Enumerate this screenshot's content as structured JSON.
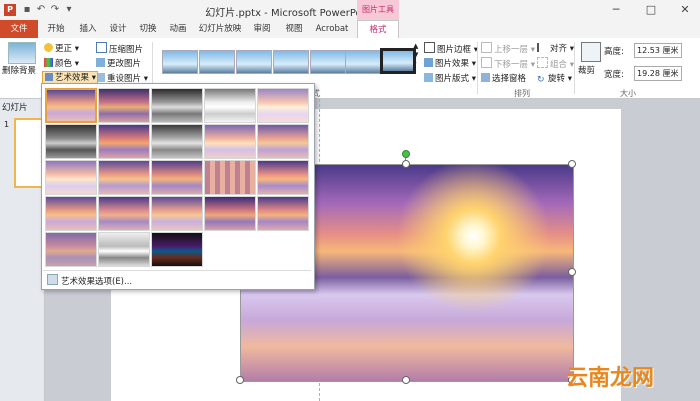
{
  "title_bar": {
    "title": "幻灯片.pptx - Microsoft PowerPoint",
    "context_tab_group": "图片工具",
    "app_icon": "P",
    "quick_access": [
      "save-icon",
      "undo-icon",
      "redo-icon",
      "customize-icon"
    ]
  },
  "tabs": [
    {
      "label": "文件"
    },
    {
      "label": "开始"
    },
    {
      "label": "插入"
    },
    {
      "label": "设计"
    },
    {
      "label": "切换"
    },
    {
      "label": "动画"
    },
    {
      "label": "幻灯片放映"
    },
    {
      "label": "审阅"
    },
    {
      "label": "视图"
    },
    {
      "label": "Acrobat"
    },
    {
      "label": "格式"
    }
  ],
  "ribbon": {
    "adjust": {
      "remove_bg": "删除背景",
      "corrections": "更正",
      "color": "颜色",
      "artistic": "艺术效果",
      "compress": "压缩图片",
      "change": "更改图片",
      "reset": "重设图片"
    },
    "styles": {
      "border": "图片边框",
      "effects": "图片效果",
      "layout": "图片版式",
      "group_label_fragment": "式"
    },
    "arrange": {
      "bring_forward": "上移一层",
      "send_backward": "下移一层",
      "selection_pane": "选择窗格",
      "align": "对齐",
      "group": "组合",
      "rotate": "旋转",
      "group_label": "排列"
    },
    "size": {
      "crop": "裁剪",
      "height_label": "高度:",
      "height_value": "12.53 厘米",
      "width_label": "宽度:",
      "width_value": "19.28 厘米",
      "group_label": "大小"
    }
  },
  "left_pane": {
    "tab": "幻灯片",
    "slide_number": "1"
  },
  "gallery": {
    "options_link": "艺术效果选项(E)...",
    "effects": [
      "none",
      "marker",
      "pencil-grayscale",
      "pencil-sketch",
      "line-drawing",
      "chalk-sketch",
      "paint-strokes",
      "paint-brush",
      "glow-diffused",
      "blur",
      "light-screen",
      "watercolor-sponge",
      "film-grain",
      "mosaic-bubbles",
      "glass",
      "cement",
      "texturizer",
      "crisscross-etching",
      "pastels-smooth",
      "plastic-wrap",
      "cutout",
      "photocopy",
      "glow-edges"
    ]
  },
  "watermark": "云南龙网",
  "colors": {
    "file_tab": "#d04b2a",
    "context_tab": "#c32a6b",
    "selection": "#e8a23d"
  }
}
